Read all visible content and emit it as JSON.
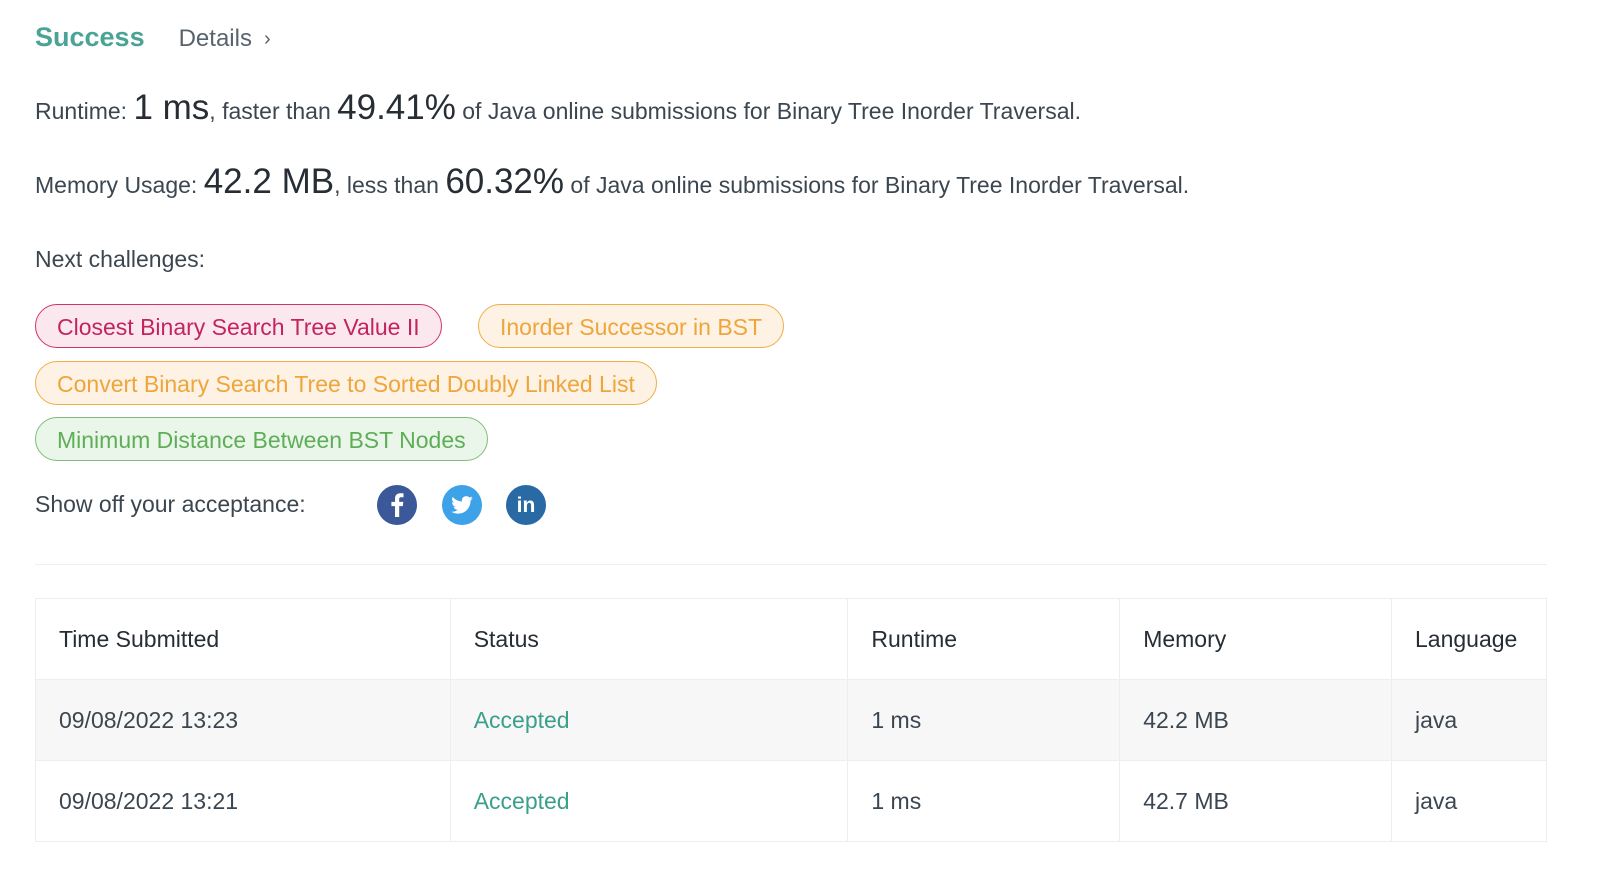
{
  "header": {
    "status": "Success",
    "details_label": "Details",
    "details_chevron": "›"
  },
  "runtime": {
    "label": "Runtime: ",
    "value": "1 ms",
    "comparison": ", faster than ",
    "percent": "49.41%",
    "suffix": " of Java online submissions for Binary Tree Inorder Traversal."
  },
  "memory": {
    "label": "Memory Usage: ",
    "value": "42.2 MB",
    "comparison": ", less than ",
    "percent": "60.32%",
    "suffix": " of Java online submissions for Binary Tree Inorder Traversal."
  },
  "next": {
    "label": "Next challenges:",
    "challenges": [
      {
        "title": "Closest Binary Search Tree Value II",
        "difficulty": "hard"
      },
      {
        "title": "Inorder Successor in BST",
        "difficulty": "medium"
      },
      {
        "title": "Convert Binary Search Tree to Sorted Doubly Linked List",
        "difficulty": "medium"
      },
      {
        "title": "Minimum Distance Between BST Nodes",
        "difficulty": "easy"
      }
    ]
  },
  "share": {
    "label": "Show off your acceptance:",
    "icons": [
      "facebook-icon",
      "twitter-icon",
      "linkedin-icon"
    ],
    "linkedin_text": "in"
  },
  "table": {
    "headers": [
      "Time Submitted",
      "Status",
      "Runtime",
      "Memory",
      "Language"
    ],
    "rows": [
      [
        "09/08/2022 13:23",
        "Accepted",
        "1 ms",
        "42.2 MB",
        "java"
      ],
      [
        "09/08/2022 13:21",
        "Accepted",
        "1 ms",
        "42.7 MB",
        "java"
      ]
    ]
  },
  "colors": {
    "success": "#4aa395",
    "hard": "#c4245e",
    "medium": "#eea53b",
    "easy": "#5eae58",
    "facebook": "#3b5998",
    "twitter": "#3ea2e8",
    "linkedin": "#2a6aa4"
  }
}
